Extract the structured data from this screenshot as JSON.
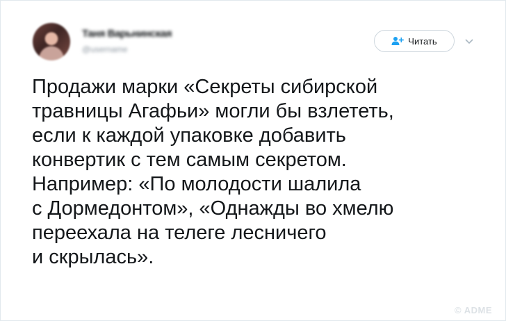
{
  "tweet": {
    "author_name": "Таня Варьнинская",
    "author_handle": "@username",
    "follow_label": "Читать",
    "icons": {
      "follow": "add-user-icon",
      "more": "chevron-down-icon"
    },
    "text_lines": [
      "Продажи марки «Секреты сибирской",
      "травницы Агафьи» могли бы взлететь,",
      "если к каждой упаковке добавить",
      "конвертик с тем самым секретом.",
      "Например: «По молодости шалила",
      "с Дормедонтом», «Однажды во хмелю",
      "переехала на телеге лесничего",
      "и скрылась»."
    ]
  },
  "watermark": "© ADME",
  "colors": {
    "accent": "#1da1f2",
    "text": "#14171a",
    "border": "#e1e8ed"
  }
}
